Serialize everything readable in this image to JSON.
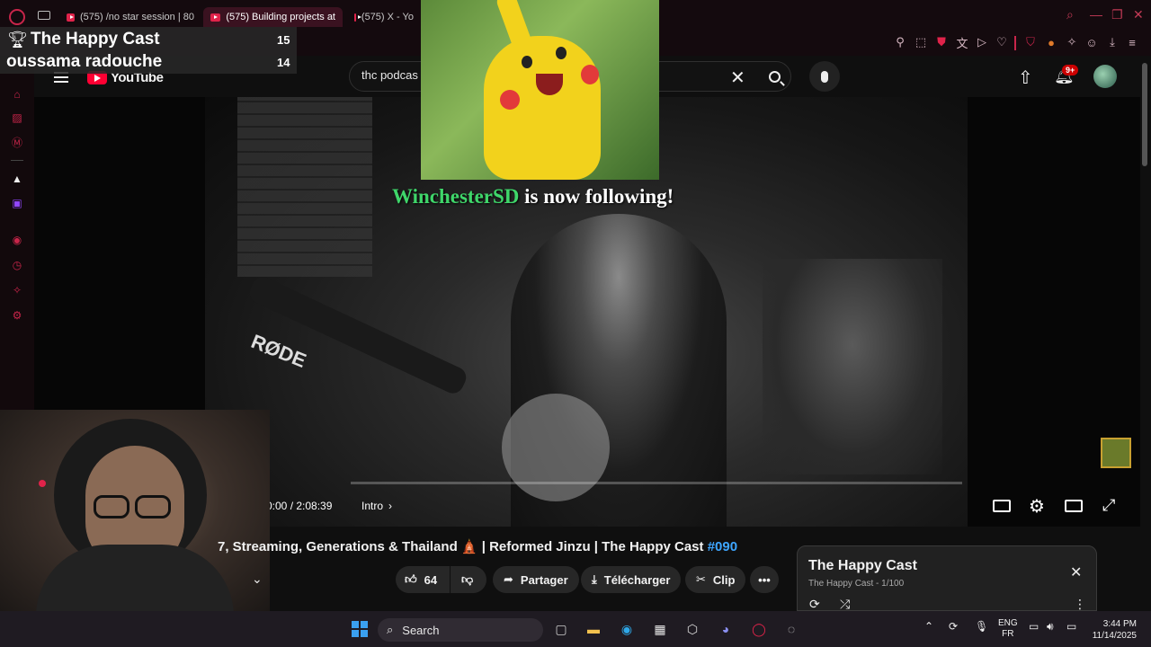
{
  "browser": {
    "tabs": [
      {
        "label": "(575) /no star session | 80"
      },
      {
        "label": "(575) Building projects at"
      },
      {
        "label": "(575) X - Yo"
      }
    ]
  },
  "youtube": {
    "logo_text": "YouTube",
    "search_value": "thc podcas",
    "notification_badge": "9+"
  },
  "stream_overlay": {
    "leaderboard": [
      {
        "name": "The Happy Cast",
        "score": "15"
      },
      {
        "name": "oussama radouche",
        "score": "14"
      }
    ],
    "follow_alert": {
      "user": "WinchesterSD",
      "message": " is now following!"
    }
  },
  "video": {
    "time": "0:00 / 2:08:39",
    "chapter": "Intro",
    "title": "7, Streaming, Generations & Thailand 🛕 | Reformed Jinzu | The Happy Cast",
    "title_tag": "#090",
    "likes": "64",
    "actions": {
      "share": "Partager",
      "download": "Télécharger",
      "clip": "Clip"
    }
  },
  "playlist_panel": {
    "title": "The Happy Cast",
    "subtitle": "The Happy Cast - 1/100"
  },
  "taskbar": {
    "search_label": "Search",
    "lang_primary": "ENG",
    "lang_secondary": "FR",
    "time": "3:44 PM",
    "date": "11/14/2025"
  },
  "colors": {
    "accent": "#c8254a",
    "youtube_red": "#ff0033",
    "follow_green": "#3fd66a",
    "link_blue": "#3ea6ff"
  }
}
